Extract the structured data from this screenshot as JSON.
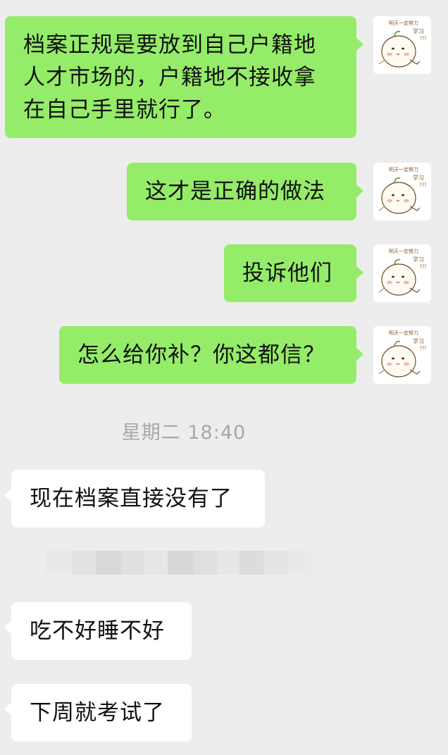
{
  "messages_out": [
    {
      "id": "m1",
      "text": "档案正规是要放到自己户籍地\n人才市场的，户籍地不接收拿\n在自己手里就行了。"
    },
    {
      "id": "m2",
      "text": "这才是正确的做法"
    },
    {
      "id": "m3",
      "text": "投诉他们"
    },
    {
      "id": "m4",
      "text": "怎么给你补？你这都信？"
    }
  ],
  "timestamp": "星期二 18:40",
  "messages_in": [
    {
      "id": "m5",
      "text": "现在档案直接没有了"
    },
    {
      "id": "m6",
      "text": "吃不好睡不好"
    },
    {
      "id": "m7",
      "text": "下周就考试了"
    }
  ],
  "avatar": {
    "caption_top": "明天一定努力",
    "caption_mid": "学习",
    "caption_exclaim": "!!!"
  },
  "colors": {
    "background": "#ededed",
    "outgoing_bubble": "#95ec69",
    "incoming_bubble": "#ffffff",
    "timestamp_text": "#a8a8a8"
  }
}
